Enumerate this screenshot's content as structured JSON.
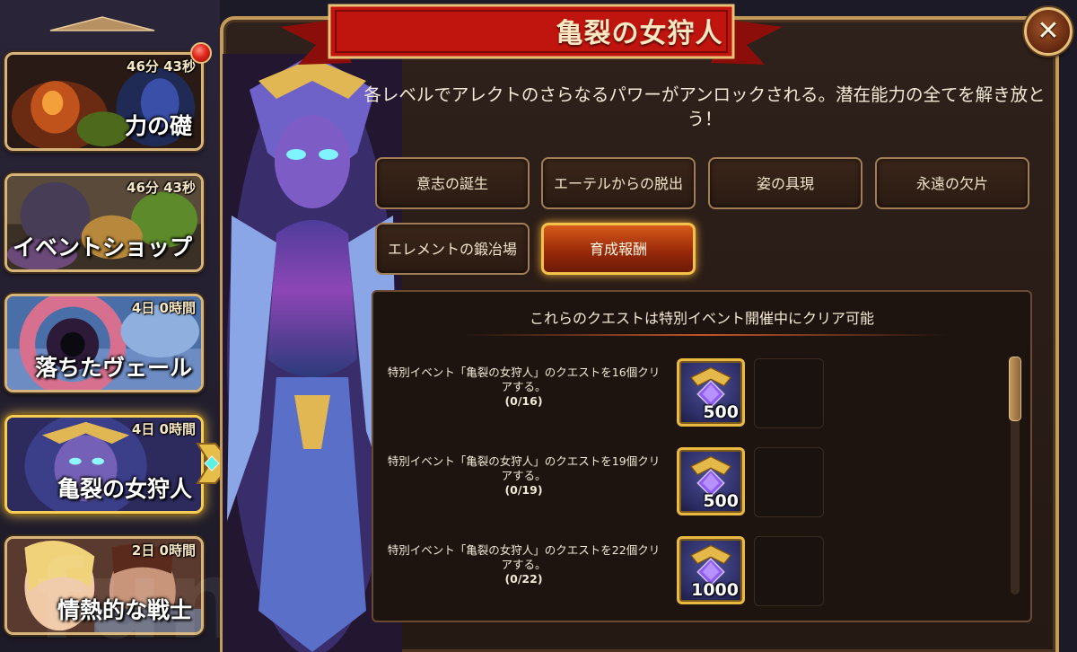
{
  "title": "亀裂の女狩人",
  "description": "各レベルでアレクトのさらなるパワーがアンロックされる。潜在能力の全てを解き放とう！",
  "colors": {
    "accent_gold": "#e9b940",
    "active_tab": "#d65a1a",
    "banner_red": "#c0140f",
    "frame_bronze": "#c39a5a"
  },
  "sidebar": {
    "events": [
      {
        "name": "力の礎",
        "timer": "46分 43秒",
        "has_badge": true,
        "selected": false
      },
      {
        "name": "イベントショップ",
        "timer": "46分 43秒",
        "selected": false
      },
      {
        "name": "落ちたヴェール",
        "timer": "4日 0時間",
        "selected": false
      },
      {
        "name": "亀裂の女狩人",
        "timer": "4日 0時間",
        "selected": true
      },
      {
        "name": "情熱的な戦士",
        "timer": "2日 0時間",
        "selected": false
      }
    ]
  },
  "tabs": [
    {
      "label": "意志の誕生",
      "active": false
    },
    {
      "label": "エーテルからの脱出",
      "active": false
    },
    {
      "label": "姿の具現",
      "active": false
    },
    {
      "label": "永遠の欠片",
      "active": false
    },
    {
      "label": "エレメントの鍛冶場",
      "active": false
    },
    {
      "label": "育成報酬",
      "active": true
    }
  ],
  "quest_panel": {
    "header": "これらのクエストは特別イベント開催中にクリア可能",
    "quests": [
      {
        "text": "特別イベント「亀裂の女狩人」のクエストを16個クリアする。",
        "progress": "(0/16)",
        "reward_amount": "500",
        "reward_icon": "emerald-gem-icon"
      },
      {
        "text": "特別イベント「亀裂の女狩人」のクエストを19個クリアする。",
        "progress": "(0/19)",
        "reward_amount": "500",
        "reward_icon": "emerald-gem-icon"
      },
      {
        "text": "特別イベント「亀裂の女狩人」のクエストを22個クリアする。",
        "progress": "(0/22)",
        "reward_amount": "1000",
        "reward_icon": "emerald-gem-icon"
      }
    ]
  }
}
